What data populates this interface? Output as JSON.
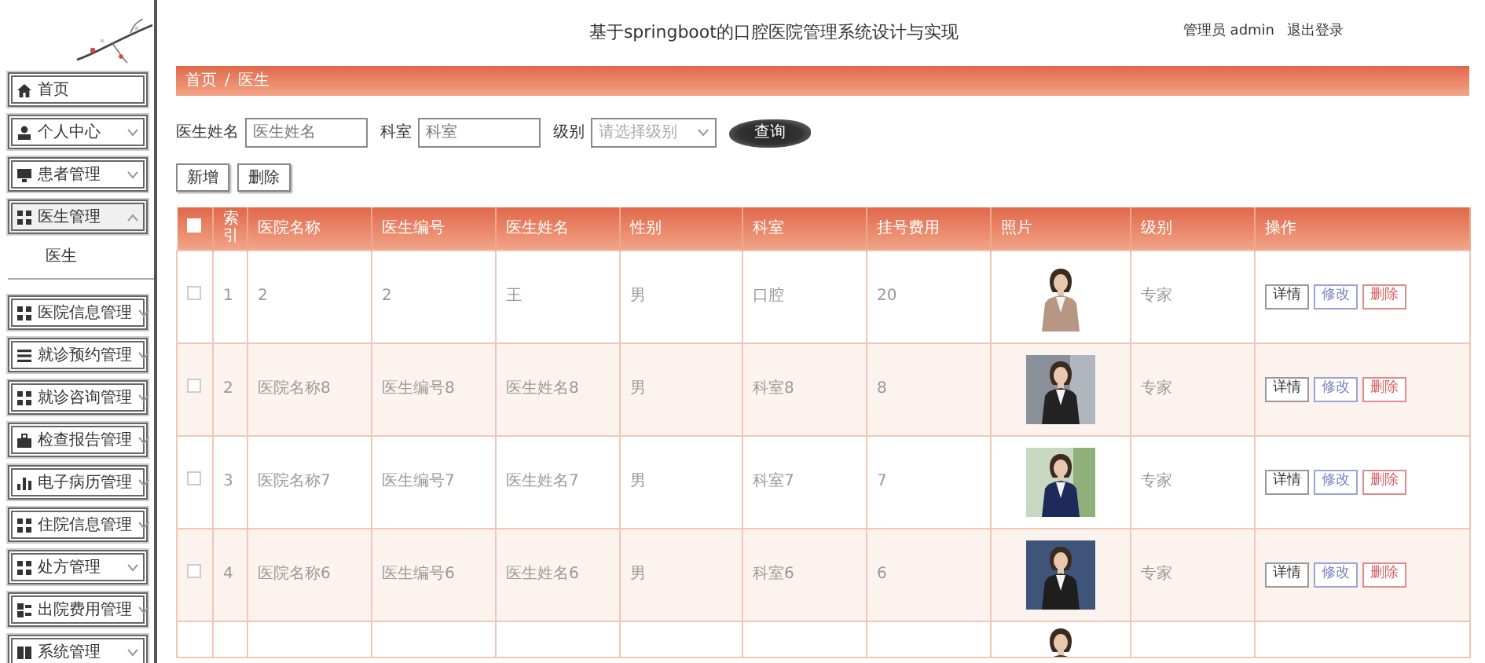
{
  "header": {
    "title": "基于springboot的口腔医院管理系统设计与实现",
    "user": "管理员 admin",
    "logout": "退出登录"
  },
  "sidebar": {
    "items": [
      {
        "label": "首页",
        "selected": false,
        "expanded": false,
        "has_menu": false
      },
      {
        "label": "个人中心",
        "selected": false,
        "expanded": false,
        "has_menu": true
      },
      {
        "label": "患者管理",
        "selected": false,
        "expanded": false,
        "has_menu": true
      },
      {
        "label": "医生管理",
        "selected": true,
        "expanded": true,
        "has_menu": true,
        "children": [
          {
            "label": "医生"
          }
        ]
      },
      {
        "label": "医院信息管理",
        "selected": false,
        "expanded": false,
        "has_menu": true
      },
      {
        "label": "就诊预约管理",
        "selected": false,
        "expanded": false,
        "has_menu": true
      },
      {
        "label": "就诊咨询管理",
        "selected": false,
        "expanded": false,
        "has_menu": true
      },
      {
        "label": "检查报告管理",
        "selected": false,
        "expanded": false,
        "has_menu": true
      },
      {
        "label": "电子病历管理",
        "selected": false,
        "expanded": false,
        "has_menu": true
      },
      {
        "label": "住院信息管理",
        "selected": false,
        "expanded": false,
        "has_menu": true
      },
      {
        "label": "处方管理",
        "selected": false,
        "expanded": false,
        "has_menu": true
      },
      {
        "label": "出院费用管理",
        "selected": false,
        "expanded": false,
        "has_menu": true
      },
      {
        "label": "系统管理",
        "selected": false,
        "expanded": false,
        "has_menu": true
      }
    ]
  },
  "breadcrumb": [
    "首页",
    "医生"
  ],
  "breadcrumb_separator": "/",
  "search": {
    "fields": [
      {
        "label": "医生姓名",
        "placeholder": "医生姓名",
        "kind": "text"
      },
      {
        "label": "科室",
        "placeholder": "科室",
        "kind": "text"
      },
      {
        "label": "级别",
        "placeholder": "请选择级别",
        "kind": "select"
      }
    ],
    "button": "查询"
  },
  "actions": [
    "新增",
    "删除"
  ],
  "table": {
    "columns": [
      "索引",
      "医院名称",
      "医生编号",
      "医生姓名",
      "性别",
      "科室",
      "挂号费用",
      "照片",
      "级别",
      "操作"
    ],
    "all_selected": false,
    "rows": [
      {
        "selected": false,
        "index": "1",
        "hospital": "2",
        "doctor_no": "2",
        "doctor_name": "王",
        "gender": "男",
        "department": "口腔",
        "fee": "20",
        "level": "专家",
        "actions": [
          "详情",
          "修改",
          "删除"
        ]
      },
      {
        "selected": false,
        "index": "2",
        "hospital": "医院名称8",
        "doctor_no": "医生编号8",
        "doctor_name": "医生姓名8",
        "gender": "男",
        "department": "科室8",
        "fee": "8",
        "level": "专家",
        "actions": [
          "详情",
          "修改",
          "删除"
        ]
      },
      {
        "selected": false,
        "index": "3",
        "hospital": "医院名称7",
        "doctor_no": "医生编号7",
        "doctor_name": "医生姓名7",
        "gender": "男",
        "department": "科室7",
        "fee": "7",
        "level": "专家",
        "actions": [
          "详情",
          "修改",
          "删除"
        ]
      },
      {
        "selected": false,
        "index": "4",
        "hospital": "医院名称6",
        "doctor_no": "医生编号6",
        "doctor_name": "医生姓名6",
        "gender": "男",
        "department": "科室6",
        "fee": "6",
        "level": "专家",
        "actions": [
          "详情",
          "修改",
          "删除"
        ]
      },
      {
        "kind": "cut"
      }
    ]
  }
}
